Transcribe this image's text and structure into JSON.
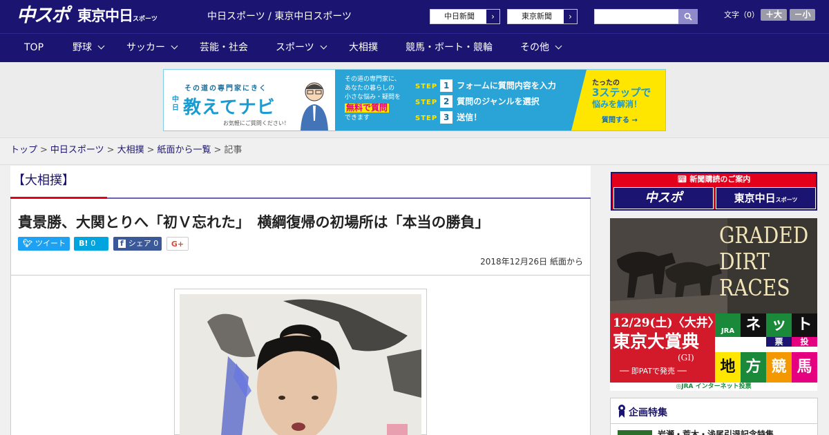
{
  "header": {
    "logo_chuspo": "中スポ",
    "logo_tokyo": "東京中日",
    "logo_tokyo_sub": "スポーツ",
    "site_names": "中日スポーツ / 東京中日スポーツ",
    "links": [
      {
        "label": "中日新聞"
      },
      {
        "label": "東京新聞"
      }
    ],
    "search": {
      "value": "",
      "placeholder": ""
    },
    "font_size_label": "文字（0）",
    "font_larger": "＋大",
    "font_smaller": "－小"
  },
  "nav": [
    {
      "label": "TOP"
    },
    {
      "label": "野球"
    },
    {
      "label": "サッカー"
    },
    {
      "label": "芸能・社会"
    },
    {
      "label": "スポーツ"
    },
    {
      "label": "大相撲"
    },
    {
      "label": "競馬・ボート・競輪"
    },
    {
      "label": "その他"
    }
  ],
  "ad_banner": {
    "tagline": "その道の専門家にきく",
    "brand_prefix": "中日",
    "brand": "教えてナビ",
    "note": "お気軽にご質問ください！",
    "mid_text_1": "その道の専門家に、",
    "mid_text_2": "あなたの暮らしの",
    "mid_text_3": "小さな悩み・疑問を",
    "mid_highlight": "無料で質問",
    "mid_text_4": "できます",
    "step_word": "STEP",
    "steps": [
      {
        "num": "1",
        "text": "フォームに質問内容を入力"
      },
      {
        "num": "2",
        "text": "質問のジャンルを選択"
      },
      {
        "num": "3",
        "text": "送信！"
      }
    ],
    "right_1": "たったの",
    "right_2": "3ステップで",
    "right_3": "悩みを解消！",
    "right_cta": "質問する →"
  },
  "breadcrumb": [
    {
      "label": "トップ"
    },
    {
      "label": "中日スポーツ"
    },
    {
      "label": "大相撲"
    },
    {
      "label": "紙面から一覧"
    },
    {
      "label": "記事"
    }
  ],
  "breadcrumb_sep": ">",
  "article": {
    "category": "【大相撲】",
    "headline": "貴景勝、大関とりへ「初Ｖ忘れた」　横綱復帰の初場所は「本当の勝負」",
    "share": {
      "tweet": "ツイート",
      "hatena_icon": "B!",
      "hatena_count": "0",
      "fb_label": "シェア",
      "fb_count": "0",
      "gplus": "G+"
    },
    "date": "2018年12月26日 紙面から"
  },
  "sidebar": {
    "subscribe_title": "新聞購読のご案内",
    "subscribe_a": "中スポ",
    "subscribe_b": "東京中日",
    "subscribe_b_sub": "スポーツ",
    "race_ad": {
      "title": "GRADED DIRT RACES",
      "date": "12/29(土)〈大井〉",
      "race": "東京大賞典",
      "grade": "(GI)",
      "pat": "── 即PATで発売 ──",
      "grid_1": "ネ",
      "grid_2": "ッ",
      "grid_3": "ト",
      "grid_4": "投",
      "grid_5": "票",
      "grid_6": "地",
      "grid_7": "方",
      "grid_8": "競",
      "grid_9": "馬",
      "logo": "JRA",
      "footer": "◎JRA インターネット投票"
    },
    "feature_title": "企画特集",
    "feature_item": "岩瀬・荒木・浅尾引退記念特集"
  },
  "colors": {
    "brand_navy": "#1b1471",
    "accent_red": "#e2001a",
    "accent_purple": "#6f5fb2"
  }
}
